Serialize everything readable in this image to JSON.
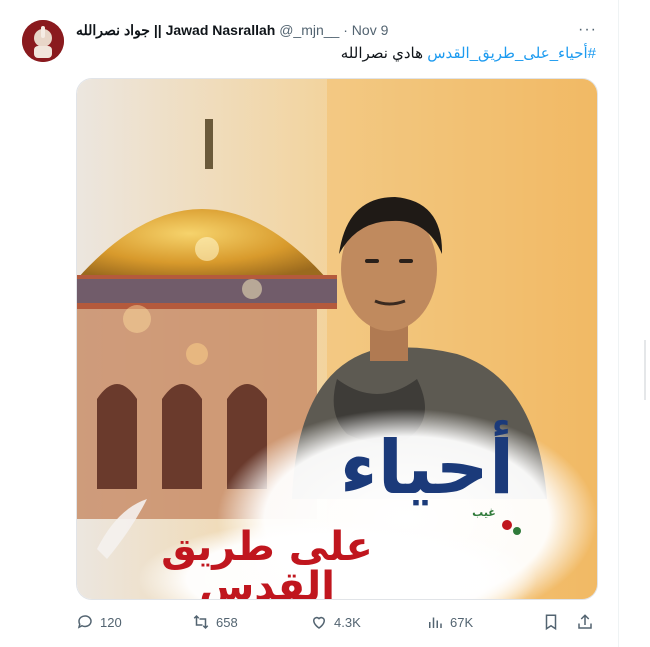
{
  "tweet": {
    "author_name": "جواد نصرالله || Jawad Nasrallah",
    "handle": "@_mjn__",
    "separator": "·",
    "date": "Nov 9",
    "more_label": "···",
    "hashtag": "#أحياء_على_طريق_القدس",
    "body_text": " هادي نصرالله",
    "media": {
      "overlay_line1": "أحياء",
      "overlay_line2": "على طريق القدس",
      "overlay_small": "غيب"
    }
  },
  "actions": {
    "replies": "120",
    "retweets": "658",
    "likes": "4.3K",
    "views": "67K"
  },
  "icons": [
    "reply-icon",
    "retweet-icon",
    "like-icon",
    "views-icon",
    "bookmark-icon",
    "share-icon"
  ],
  "colors": {
    "link": "#1d9bf0",
    "muted": "#536471",
    "text": "#0f1419",
    "brand_red": "#c0161e",
    "brand_blue": "#1b3a7a"
  }
}
